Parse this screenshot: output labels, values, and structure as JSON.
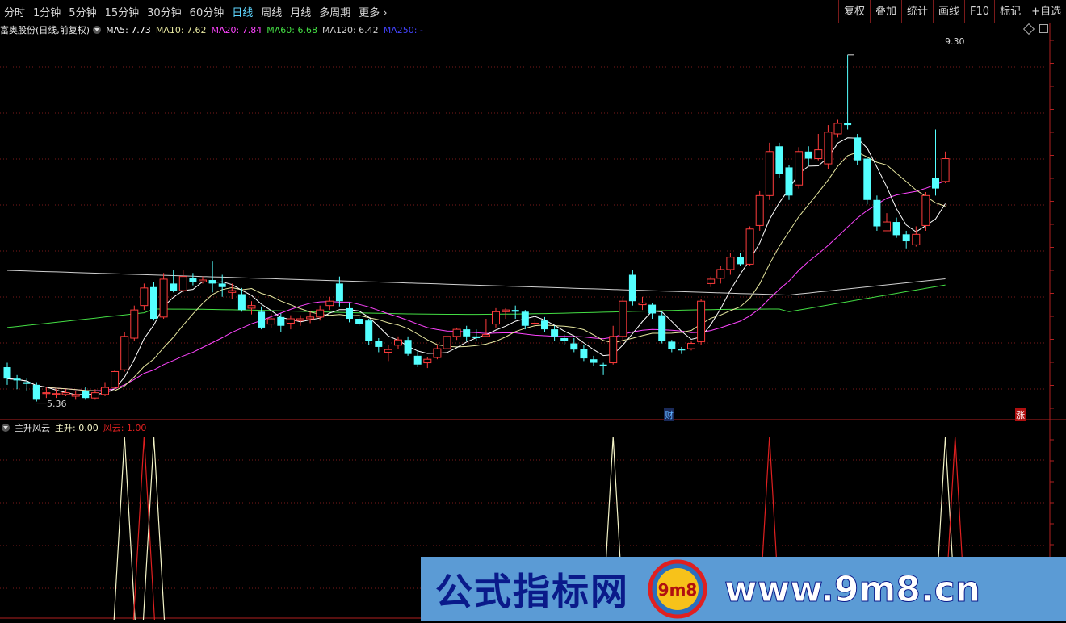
{
  "toolbar": {
    "periods": [
      "分时",
      "1分钟",
      "5分钟",
      "15分钟",
      "30分钟",
      "60分钟",
      "日线",
      "周线",
      "月线",
      "多周期",
      "更多"
    ],
    "active_period": "日线",
    "right_buttons": [
      "复权",
      "叠加",
      "统计",
      "画线",
      "F10",
      "标记",
      "+自选"
    ]
  },
  "legend": {
    "title": "富奥股份(日线,前复权)",
    "ma5": "MA5: 7.73",
    "ma10": "MA10: 7.62",
    "ma20": "MA20: 7.84",
    "ma60": "MA60: 6.68",
    "ma120": "MA120: 6.42",
    "ma250": "MA250: -",
    "colors": {
      "ma5": "#ffffff",
      "ma10": "#e8e8a0",
      "ma20": "#ff44ff",
      "ma60": "#44dd44",
      "ma120": "#d0d0d0",
      "ma250": "#4444ff"
    }
  },
  "price_labels": {
    "high": "9.30",
    "low": "5.36"
  },
  "markers": {
    "cai": "财",
    "zhang": "涨"
  },
  "indicator": {
    "name": "主升风云",
    "zhusheng": "主升: 0.00",
    "fengyun": "风云: 1.00"
  },
  "watermark": {
    "left_text": "公式指标网",
    "right_text": "www.9m8.cn",
    "logo_text": "9m8"
  },
  "colors": {
    "up": "#ff3c3c",
    "down": "#54ffff",
    "grid": "#7a1a1a",
    "signal_white": "#f5f5c8",
    "signal_red": "#e02020"
  },
  "chart_data": {
    "type": "candlestick",
    "ylim": [
      5.2,
      9.5
    ],
    "candles": [
      [
        5.75,
        5.62,
        5.8,
        5.55
      ],
      [
        5.62,
        5.6,
        5.66,
        5.5
      ],
      [
        5.58,
        5.56,
        5.62,
        5.48
      ],
      [
        5.55,
        5.38,
        5.58,
        5.36
      ],
      [
        5.45,
        5.46,
        5.52,
        5.4
      ],
      [
        5.44,
        5.45,
        5.5,
        5.4
      ],
      [
        5.44,
        5.46,
        5.5,
        5.42
      ],
      [
        5.42,
        5.44,
        5.48,
        5.38
      ],
      [
        5.48,
        5.4,
        5.52,
        5.38
      ],
      [
        5.4,
        5.46,
        5.5,
        5.38
      ],
      [
        5.44,
        5.52,
        5.58,
        5.42
      ],
      [
        5.52,
        5.7,
        5.72,
        5.5
      ],
      [
        5.72,
        6.1,
        6.15,
        5.7
      ],
      [
        6.08,
        6.4,
        6.45,
        6.05
      ],
      [
        6.45,
        6.65,
        6.7,
        6.4
      ],
      [
        6.66,
        6.3,
        6.72,
        6.28
      ],
      [
        6.32,
        6.75,
        6.82,
        6.3
      ],
      [
        6.7,
        6.62,
        6.85,
        6.6
      ],
      [
        6.62,
        6.78,
        6.85,
        6.6
      ],
      [
        6.76,
        6.72,
        6.82,
        6.68
      ],
      [
        6.72,
        6.74,
        6.78,
        6.7
      ],
      [
        6.74,
        6.7,
        6.95,
        6.6
      ],
      [
        6.7,
        6.66,
        6.8,
        6.55
      ],
      [
        6.6,
        6.62,
        6.7,
        6.52
      ],
      [
        6.58,
        6.4,
        6.65,
        6.38
      ],
      [
        6.42,
        6.45,
        6.5,
        6.35
      ],
      [
        6.38,
        6.2,
        6.44,
        6.18
      ],
      [
        6.24,
        6.3,
        6.36,
        6.2
      ],
      [
        6.32,
        6.22,
        6.36,
        6.15
      ],
      [
        6.25,
        6.3,
        6.34,
        6.18
      ],
      [
        6.28,
        6.3,
        6.34,
        6.22
      ],
      [
        6.3,
        6.32,
        6.38,
        6.25
      ],
      [
        6.32,
        6.4,
        6.45,
        6.28
      ],
      [
        6.45,
        6.5,
        6.55,
        6.4
      ],
      [
        6.7,
        6.5,
        6.78,
        6.44
      ],
      [
        6.42,
        6.3,
        6.48,
        6.26
      ],
      [
        6.3,
        6.24,
        6.32,
        6.22
      ],
      [
        6.28,
        6.05,
        6.3,
        6.0
      ],
      [
        6.05,
        5.98,
        6.08,
        5.92
      ],
      [
        5.92,
        5.95,
        6.0,
        5.82
      ],
      [
        6.0,
        6.06,
        6.1,
        5.96
      ],
      [
        6.06,
        5.9,
        6.1,
        5.88
      ],
      [
        5.88,
        5.78,
        5.94,
        5.75
      ],
      [
        5.8,
        5.84,
        5.86,
        5.74
      ],
      [
        5.86,
        5.96,
        6.0,
        5.84
      ],
      [
        5.96,
        6.1,
        6.15,
        5.9
      ],
      [
        6.1,
        6.18,
        6.2,
        6.06
      ],
      [
        6.18,
        6.1,
        6.22,
        6.05
      ],
      [
        6.1,
        6.08,
        6.18,
        6.05
      ],
      [
        6.1,
        6.12,
        6.3,
        6.1
      ],
      [
        6.24,
        6.38,
        6.42,
        6.2
      ],
      [
        6.38,
        6.4,
        6.42,
        6.3
      ],
      [
        6.4,
        6.38,
        6.45,
        6.3
      ],
      [
        6.38,
        6.22,
        6.4,
        6.18
      ],
      [
        6.24,
        6.25,
        6.3,
        6.2
      ],
      [
        6.28,
        6.18,
        6.32,
        6.15
      ],
      [
        6.18,
        6.1,
        6.22,
        6.05
      ],
      [
        6.08,
        6.05,
        6.12,
        6.0
      ],
      [
        6.02,
        5.95,
        6.08,
        5.92
      ],
      [
        5.96,
        5.85,
        6.0,
        5.82
      ],
      [
        5.84,
        5.8,
        5.88,
        5.76
      ],
      [
        5.78,
        5.76,
        5.8,
        5.66
      ],
      [
        5.8,
        6.1,
        6.22,
        5.78
      ],
      [
        6.1,
        6.5,
        6.55,
        6.05
      ],
      [
        6.8,
        6.5,
        6.85,
        6.45
      ],
      [
        6.46,
        6.48,
        6.55,
        6.4
      ],
      [
        6.46,
        6.36,
        6.48,
        6.3
      ],
      [
        6.34,
        6.05,
        6.38,
        6.02
      ],
      [
        6.04,
        5.96,
        6.06,
        5.92
      ],
      [
        5.96,
        5.94,
        5.98,
        5.9
      ],
      [
        5.96,
        6.02,
        6.04,
        5.94
      ],
      [
        6.04,
        6.5,
        6.52,
        6.0
      ],
      [
        6.7,
        6.75,
        6.78,
        6.66
      ],
      [
        6.76,
        6.86,
        6.9,
        6.7
      ],
      [
        6.86,
        7.0,
        7.05,
        6.8
      ],
      [
        7.0,
        6.92,
        7.05,
        6.9
      ],
      [
        6.92,
        7.32,
        7.35,
        6.9
      ],
      [
        7.36,
        7.7,
        7.75,
        7.3
      ],
      [
        7.7,
        8.2,
        8.3,
        7.65
      ],
      [
        8.26,
        7.95,
        8.3,
        7.9
      ],
      [
        8.02,
        7.7,
        8.05,
        7.65
      ],
      [
        7.82,
        8.2,
        8.25,
        7.78
      ],
      [
        8.2,
        8.12,
        8.26,
        8.04
      ],
      [
        8.12,
        8.22,
        8.4,
        8.1
      ],
      [
        8.06,
        8.42,
        8.5,
        8.0
      ],
      [
        8.4,
        8.52,
        8.56,
        8.36
      ],
      [
        8.52,
        8.5,
        9.3,
        8.45
      ],
      [
        8.36,
        8.1,
        8.4,
        8.05
      ],
      [
        8.12,
        7.65,
        8.14,
        7.6
      ],
      [
        7.65,
        7.35,
        7.7,
        7.3
      ],
      [
        7.3,
        7.4,
        7.5,
        7.3
      ],
      [
        7.4,
        7.25,
        7.45,
        7.22
      ],
      [
        7.26,
        7.18,
        7.3,
        7.1
      ],
      [
        7.14,
        7.26,
        7.35,
        7.12
      ],
      [
        7.36,
        7.7,
        7.74,
        7.3
      ],
      [
        7.9,
        7.78,
        8.45,
        7.7
      ],
      [
        7.86,
        8.12,
        8.2,
        7.84
      ]
    ],
    "signals": {
      "zhusheng": [
        0,
        0,
        0,
        0,
        0,
        0,
        0,
        0,
        0,
        0,
        0,
        0,
        1,
        0,
        0,
        1,
        0,
        0,
        0,
        0,
        0,
        0,
        0,
        0,
        0,
        0,
        0,
        0,
        0,
        0,
        0,
        0,
        0,
        0,
        0,
        0,
        0,
        0,
        0,
        0,
        0,
        0,
        0,
        0,
        0,
        0,
        0,
        0,
        0,
        0,
        0,
        0,
        0,
        0,
        0,
        0,
        0,
        0,
        0,
        0,
        0,
        0,
        1,
        0,
        0,
        0,
        0,
        0,
        0,
        0,
        0,
        0,
        0,
        0,
        0,
        0,
        0,
        0,
        0,
        0,
        0,
        0,
        0,
        0,
        0,
        0,
        0,
        0,
        0,
        0,
        0,
        0,
        0,
        0,
        0,
        0,
        1
      ],
      "fengyun": [
        0,
        0,
        0,
        0,
        0,
        0,
        0,
        0,
        0,
        0,
        0,
        0,
        0,
        0,
        1,
        0,
        0,
        0,
        0,
        0,
        0,
        0,
        0,
        0,
        0,
        0,
        0,
        0,
        0,
        0,
        0,
        0,
        0,
        0,
        0,
        0,
        0,
        0,
        0,
        0,
        0,
        0,
        0,
        0,
        0,
        0,
        0,
        0,
        0,
        0,
        0,
        0,
        0,
        0,
        0,
        0,
        0,
        0,
        0,
        0,
        0,
        0,
        0,
        0,
        0,
        0,
        0,
        0,
        0,
        0,
        0,
        0,
        0,
        0,
        0,
        0,
        0,
        0,
        1,
        0,
        0,
        0,
        0,
        0,
        0,
        0,
        0,
        0,
        0,
        0,
        0,
        0,
        0,
        0,
        0,
        0,
        0,
        1
      ]
    }
  }
}
